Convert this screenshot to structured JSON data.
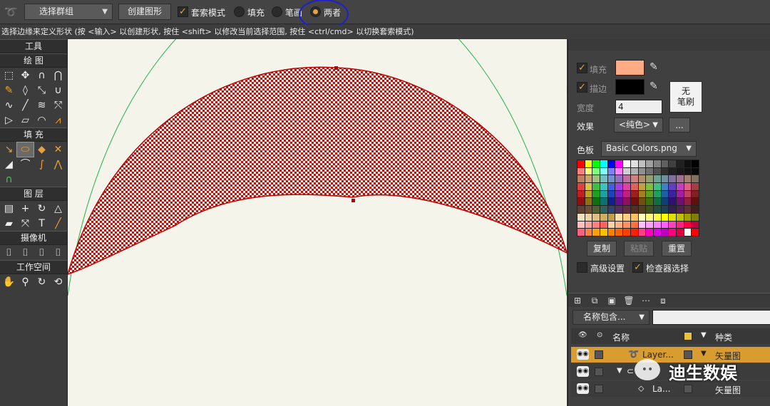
{
  "toolbar": {
    "lasso_icon": "lasso-icon",
    "select_group": "选择群组",
    "create_shape": "创建图形",
    "lasso_mode": "套索模式",
    "fill": "填充",
    "stroke": "笔画",
    "both": "两者"
  },
  "hint": "选择边缘来定义形状 (按 <输入> 以创建形状, 按住 <shift> 以修改当前选择范围, 按住 <ctrl/cmd> 以切换套索模式)",
  "tools_panel": {
    "title": "工具",
    "sections": [
      "绘 图",
      "填 充",
      "图 层",
      "摄像机",
      "工作空间"
    ]
  },
  "props": {
    "fill_label": "填充",
    "fill_color": "#ffab83",
    "stroke_label": "描边",
    "stroke_color": "#000000",
    "no_brush_line1": "无",
    "no_brush_line2": "笔刷",
    "width_label": "宽度",
    "width_value": "4",
    "effect_label": "效果",
    "effect_value": "<纯色>",
    "effect_more": "...",
    "palette_label": "色板",
    "palette_value": "Basic Colors.png",
    "copy": "复制",
    "paste": "粘贴",
    "reset": "重置",
    "advanced": "高级设置",
    "inspector_select": "检查器选择"
  },
  "layers": {
    "filter_value": "名称包含...",
    "col_name": "名称",
    "col_type": "种类",
    "rows": [
      {
        "name": "Layer...",
        "type": "矢量图"
      },
      {
        "name": "",
        "type": ""
      },
      {
        "name": "La...",
        "type": "矢量图"
      }
    ]
  },
  "watermark": "迪生数娱"
}
